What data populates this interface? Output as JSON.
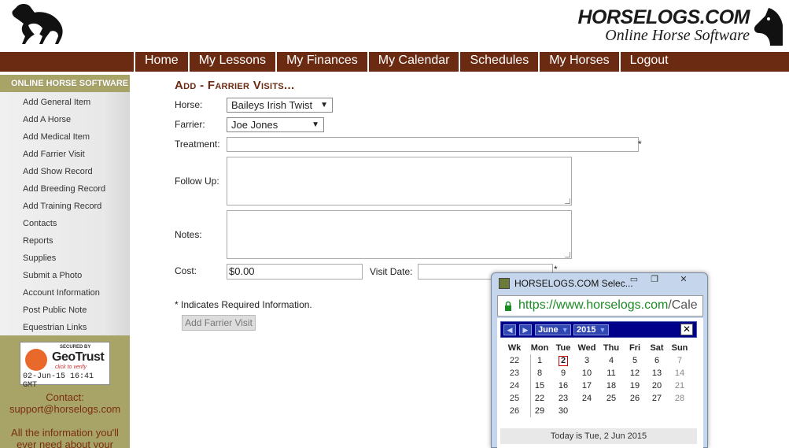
{
  "header": {
    "brand_title": "HORSELOGS.COM",
    "brand_subtitle": "Online Horse Software"
  },
  "nav": {
    "items": [
      "Home",
      "My Lessons",
      "My Finances",
      "My Calendar",
      "Schedules",
      "My Horses",
      "Logout"
    ]
  },
  "sidebar": {
    "heading": "ONLINE HORSE SOFTWARE",
    "items": [
      "Add General Item",
      "Add A Horse",
      "Add Medical Item",
      "Add Farrier Visit",
      "Add Show Record",
      "Add Breeding Record",
      "Add Training Record",
      "Contacts",
      "Reports",
      "Supplies",
      "Submit a Photo",
      "Account Information",
      "Post Public Note",
      "Equestrian Links"
    ],
    "seal": {
      "secured_by": "SECURED BY",
      "brand": "GeoTrust",
      "click": "click to verify",
      "date": "02-Jun-15 16:41 GMT"
    },
    "contact_label": "Contact:",
    "contact_email": "support@horselogs.com",
    "info_text": "All the information you'll ever need about your"
  },
  "form": {
    "title": "Add - Farrier Visits...",
    "horse_label": "Horse:",
    "horse_value": "Baileys Irish Twist",
    "farrier_label": "Farrier:",
    "farrier_value": "Joe Jones",
    "treatment_label": "Treatment:",
    "followup_label": "Follow Up:",
    "notes_label": "Notes:",
    "cost_label": "Cost:",
    "cost_value": "$0.00",
    "visit_date_label": "Visit Date:",
    "required_star": "*",
    "required_note": "* Indicates Required Information.",
    "submit_label": "Add Farrier Visit"
  },
  "popup": {
    "title": "HORSELOGS.COM Selec...",
    "url_host": "https://www.horselogs.com",
    "url_path": "/Cale",
    "calendar": {
      "month": "June",
      "year": "2015",
      "headers": [
        "Wk",
        "Mon",
        "Tue",
        "Wed",
        "Thu",
        "Fri",
        "Sat",
        "Sun"
      ],
      "weeks": [
        [
          "22",
          "1",
          "2",
          "3",
          "4",
          "5",
          "6",
          "7"
        ],
        [
          "23",
          "8",
          "9",
          "10",
          "11",
          "12",
          "13",
          "14"
        ],
        [
          "24",
          "15",
          "16",
          "17",
          "18",
          "19",
          "20",
          "21"
        ],
        [
          "25",
          "22",
          "23",
          "24",
          "25",
          "26",
          "27",
          "28"
        ],
        [
          "26",
          "29",
          "30",
          "",
          "",
          "",
          "",
          ""
        ]
      ],
      "today_footer": "Today is Tue, 2 Jun 2015",
      "close_glyph": "✕"
    }
  },
  "colors": {
    "nav_bg": "#6b2a12",
    "sidebar_accent": "#a8a468",
    "calendar_header": "#00008b"
  }
}
